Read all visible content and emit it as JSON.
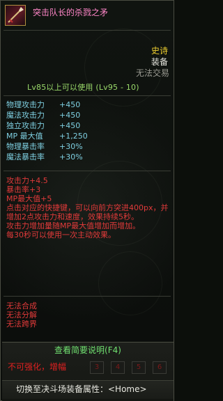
{
  "item": {
    "name": "突击队长的杀戮之矛",
    "icon": "spear-icon",
    "rarity": "史诗",
    "slot": "装备",
    "trade": "无法交易",
    "level_requirement": "Lv85以上可以使用 (Lv95 - 10)"
  },
  "stats": [
    {
      "label": "物理攻击力",
      "value": "+450"
    },
    {
      "label": "魔法攻击力",
      "value": "+450"
    },
    {
      "label": "独立攻击力",
      "value": "+450"
    },
    {
      "label": "MP 最大值",
      "value": "+1,250"
    },
    {
      "label": "物理暴击率",
      "value": "+30%"
    },
    {
      "label": "魔法暴击率",
      "value": "+30%"
    }
  ],
  "effects": {
    "line1": "攻击力+4.5",
    "line2": "暴击率+3",
    "line3": "MP最大值+5",
    "line4": "点击对应的快捷键，可以向前方突进400px，并增加2点攻击力和速度，效果持续5秒。",
    "line5": "攻击力增加量随MP最大值增加而增加。",
    "line6": "每30秒可以使用一次主动效果。"
  },
  "restrictions": [
    "无法合成",
    "无法分解",
    "无法跨界"
  ],
  "bottom": {
    "brief_label": "查看简要说明(F4)",
    "enhance_label": "不可强化，增幅",
    "slots": [
      "3",
      "4",
      "5",
      "6"
    ],
    "switch_label": "切换至决斗场装备属性：<Home>"
  },
  "colors": {
    "name": "#ff86c8",
    "rarity": "#f0d030",
    "stats": "#7fd0e2",
    "effects": "#e23a3a",
    "level": "#9ad96a",
    "brief": "#70e070"
  }
}
